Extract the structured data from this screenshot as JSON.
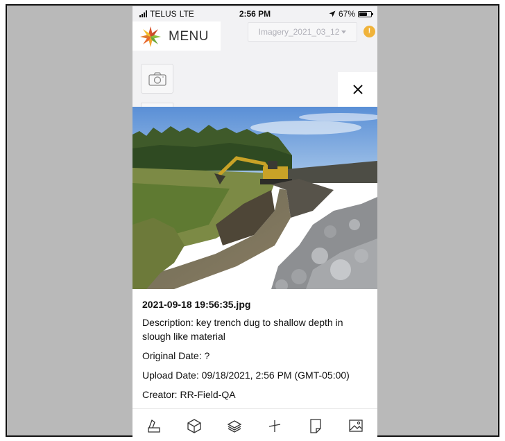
{
  "status_bar": {
    "carrier": "TELUS",
    "network": "LTE",
    "time": "2:56 PM",
    "battery": "67%",
    "battery_level": 0.67
  },
  "header": {
    "menu_label": "MENU",
    "imagery_label": "Imagery_2021_03_12",
    "alert_symbol": "!"
  },
  "photo_panel": {
    "filename": "2021-09-18 19:56:35.jpg",
    "description": "Description: key trench dug to shallow depth in slough like material",
    "original_date": "Original Date: ?",
    "upload_date": "Upload Date: 09/18/2021, 2:56 PM (GMT-05:00)",
    "creator": "Creator: RR-Field-QA"
  },
  "toolbar": {
    "icons": [
      "measure-icon",
      "3d-box-icon",
      "layers-icon",
      "draw-icon",
      "page-icon",
      "image-icon"
    ]
  },
  "colors": {
    "alert": "#f0b33a",
    "frame_bg": "#b9b9b9",
    "app_bg": "#f2f2f4"
  }
}
